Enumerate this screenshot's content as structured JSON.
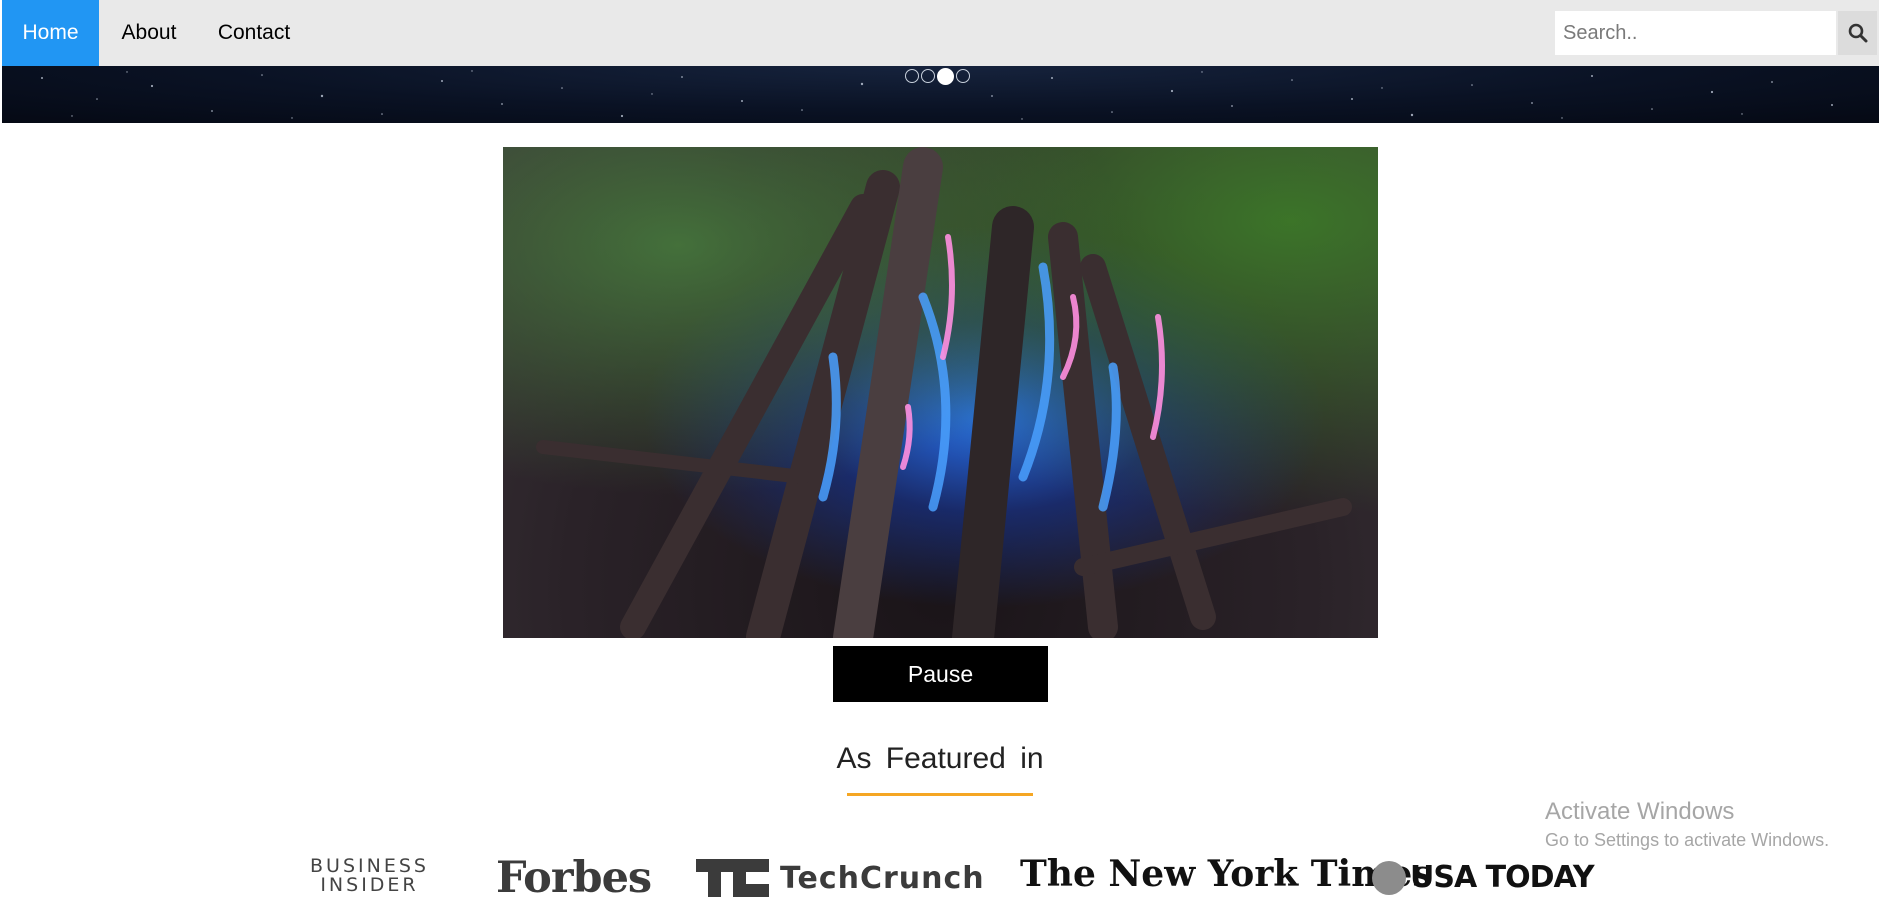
{
  "nav": {
    "home": "Home",
    "about": "About",
    "contact": "Contact",
    "search_placeholder": "Search..",
    "search_icon": "search-icon",
    "active_color": "#2196f3"
  },
  "slider": {
    "dot_count": 4,
    "active_index": 2
  },
  "video": {
    "pause_label": "Pause"
  },
  "featured": {
    "title": "As Featured in",
    "accent": "#f5a623",
    "logos": {
      "business_insider_line1": "BUSINESS",
      "business_insider_line2": "INSIDER",
      "forbes": "Forbes",
      "techcrunch": "TechCrunch",
      "nyt": "The New York Times",
      "usatoday": "USA TODAY"
    }
  },
  "watermark": {
    "title": "Activate Windows",
    "subtitle": "Go to Settings to activate Windows."
  }
}
